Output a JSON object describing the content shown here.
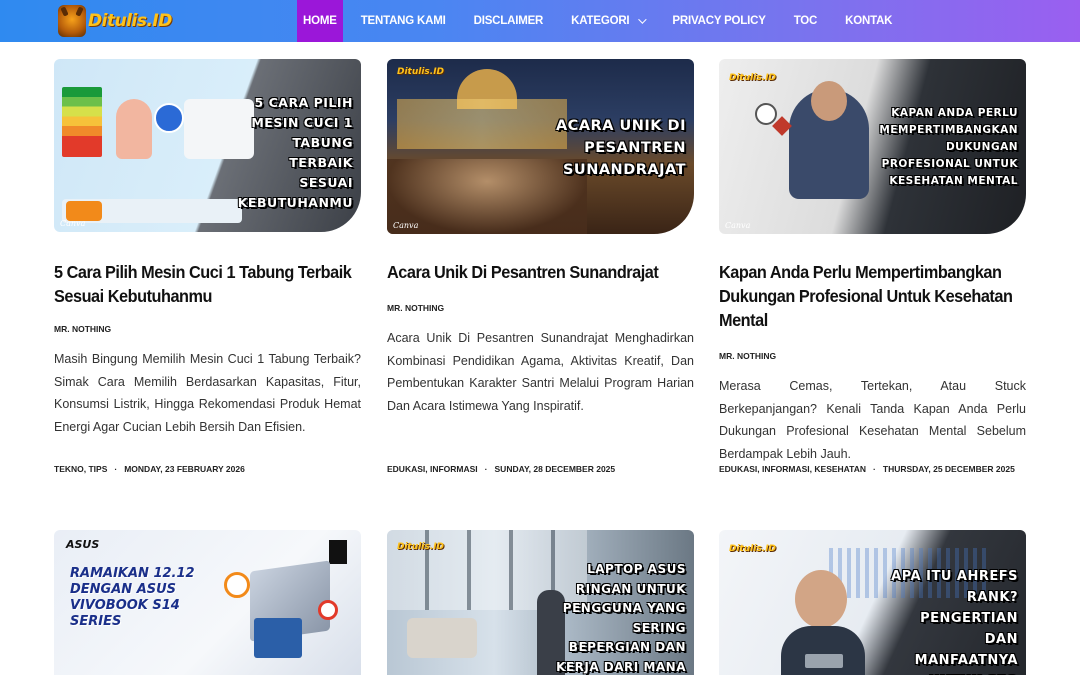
{
  "site": {
    "logo_text": "Ditulis.ID",
    "nav": [
      {
        "label": "HOME",
        "active": true
      },
      {
        "label": "TENTANG KAMI"
      },
      {
        "label": "DISCLAIMER"
      },
      {
        "label": "KATEGORI",
        "dropdown": true
      },
      {
        "label": "PRIVACY POLICY"
      },
      {
        "label": "TOC"
      },
      {
        "label": "KONTAK"
      }
    ],
    "colors": {
      "header_start": "#2f8af0",
      "header_end": "#9a5ff0",
      "active_nav": "#9b17d9"
    }
  },
  "posts": [
    {
      "thumb_caption": "5 CARA PILIH MESIN CUCI 1 TABUNG TERBAIK SESUAI KEBUTUHANMU",
      "thumb_brand": "Ditulis.ID",
      "title": "5 Cara Pilih Mesin Cuci 1 Tabung Terbaik Sesuai Kebutuhanmu",
      "author": "MR. NOTHING",
      "excerpt": "Masih Bingung Memilih Mesin Cuci 1 Tabung Terbaik? Simak Cara Memilih Berdasarkan Kapasitas, Fitur, Konsumsi Listrik, Hingga Rekomendasi Produk Hemat Energi Agar Cucian Lebih Bersih Dan Efisien.",
      "categories": "TEKNO, TIPS",
      "date": "MONDAY, 23 FEBRUARY 2026"
    },
    {
      "thumb_caption": "ACARA UNIK DI PESANTREN SUNANDRAJAT",
      "thumb_brand": "Ditulis.ID",
      "title": "Acara Unik Di Pesantren Sunandrajat",
      "author": "MR. NOTHING",
      "excerpt": "Acara Unik Di Pesantren Sunandrajat Menghadirkan Kombinasi Pendidikan Agama, Aktivitas Kreatif, Dan Pembentukan Karakter Santri Melalui Program Harian Dan Acara Istimewa Yang Inspiratif.",
      "categories": "EDUKASI, INFORMASI",
      "date": "SUNDAY, 28 DECEMBER 2025"
    },
    {
      "thumb_caption": "KAPAN ANDA PERLU MEMPERTIMBANGKAN DUKUNGAN PROFESIONAL UNTUK KESEHATAN MENTAL",
      "thumb_brand": "Ditulis.ID",
      "title": "Kapan Anda Perlu Mempertimbangkan Dukungan Profesional Untuk Kesehatan Mental",
      "author": "MR. NOTHING",
      "excerpt": "Merasa Cemas, Tertekan, Atau Stuck Berkepanjangan? Kenali Tanda Kapan Anda Perlu Dukungan Profesional Kesehatan Mental Sebelum Berdampak Lebih Jauh.",
      "categories": "EDUKASI, INFORMASI, KESEHATAN",
      "date": "THURSDAY, 25 DECEMBER 2025"
    },
    {
      "thumb_caption": "RAMAIKAN 12.12 DENGAN ASUS VIVOBOOK S14 SERIES",
      "thumb_brand": "ASUS"
    },
    {
      "thumb_caption": "LAPTOP ASUS RINGAN UNTUK PENGGUNA YANG SERING BEPERGIAN DAN KERJA DARI MANA SAJA",
      "thumb_brand": "Ditulis.ID"
    },
    {
      "thumb_caption": "APA ITU AHREFS RANK? PENGERTIAN DAN MANFAATNYA UNTUK SEO",
      "thumb_brand": "Ditulis.ID"
    }
  ]
}
